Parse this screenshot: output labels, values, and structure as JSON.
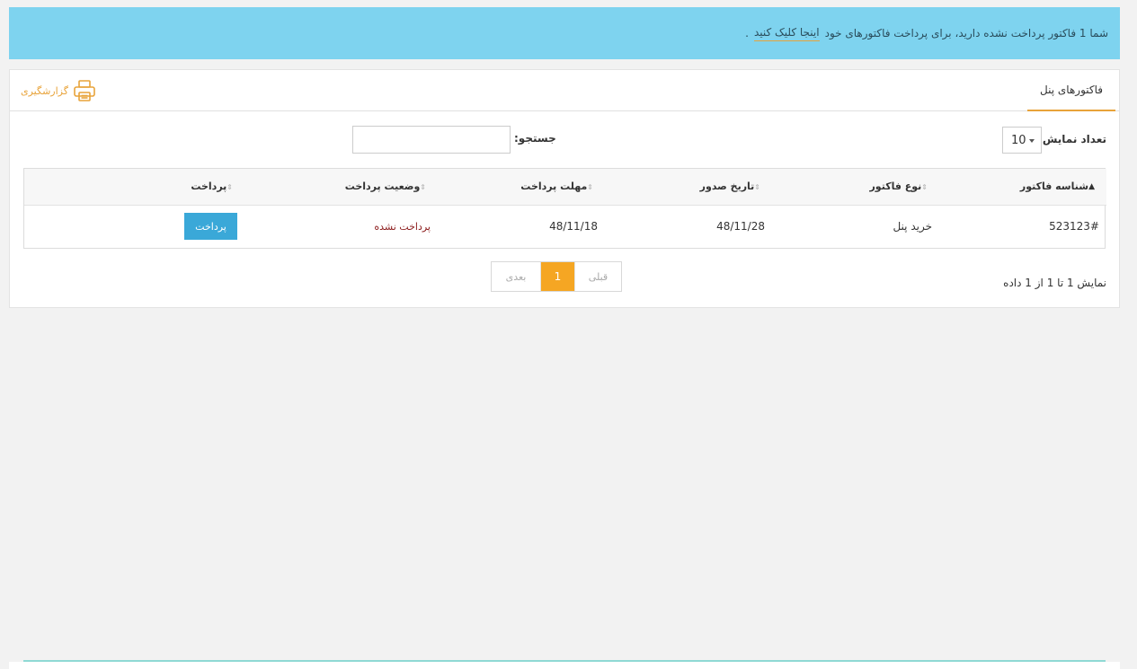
{
  "alert": {
    "message": "شما 1 فاکتور پرداخت نشده دارید، برای پرداخت فاکتورهای خود",
    "link_label": "اینجا کلیک کنید",
    "trailing": "."
  },
  "panel": {
    "title": "فاکتورهای پنل",
    "report_label": "گزارشگیری"
  },
  "controls": {
    "length_label": "تعداد نمایش",
    "length_value": "10",
    "search_label": "جستجو:",
    "search_value": ""
  },
  "table": {
    "columns": [
      "شناسه فاکتور",
      "نوع فاکتور",
      "تاریخ صدور",
      "مهلت پرداخت",
      "وضعیت پرداخت",
      "پرداخت"
    ],
    "rows": [
      {
        "id": "523123#",
        "type": "خرید پنل",
        "issue_date": "48/11/28",
        "due_date": "48/11/18",
        "status": "پرداخت نشده",
        "action": "پرداخت"
      }
    ]
  },
  "info": "نمایش 1 تا 1 از 1 داده",
  "pagination": {
    "prev": "قبلی",
    "current": "1",
    "next": "بعدی"
  },
  "colors": {
    "alert_bg": "#7ed3ef",
    "accent": "#e8a33a",
    "pay_button": "#3aa8d8",
    "current_page": "#f5a623",
    "unpaid_status": "#8b1a1a"
  },
  "icons": {
    "report": "printer-icon",
    "sort_active": "sort-asc-icon",
    "sort": "sort-icon"
  }
}
